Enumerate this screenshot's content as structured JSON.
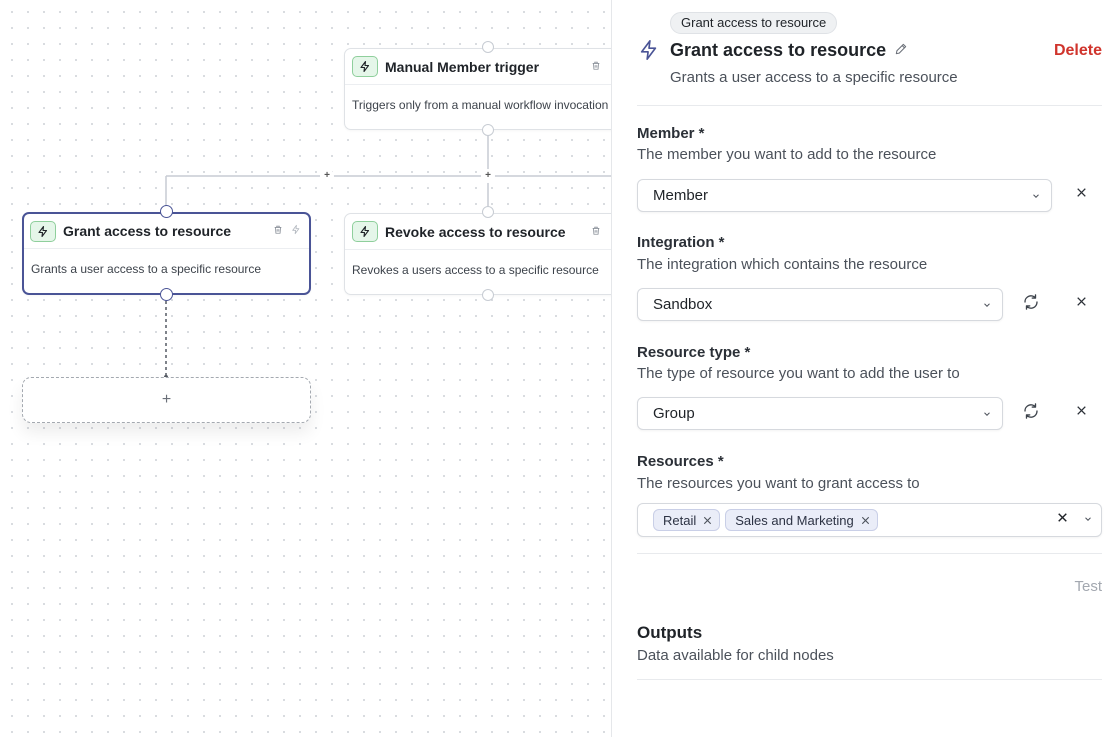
{
  "canvas": {
    "nodes": {
      "manual_trigger": {
        "title": "Manual Member trigger",
        "description": "Triggers only from a manual workflow invocation"
      },
      "grant": {
        "title": "Grant access to resource",
        "description": "Grants a user access to a specific resource"
      },
      "revoke": {
        "title": "Revoke access to resource",
        "description": "Revokes a users access to a specific resource"
      }
    },
    "add_node_label": "+",
    "plus_label": "+"
  },
  "panel": {
    "chip": "Grant access to resource",
    "title": "Grant access to resource",
    "subtitle": "Grants a user access to a specific resource",
    "delete_label": "Delete",
    "fields": {
      "member": {
        "label": "Member *",
        "help": "The member you want to add to the resource",
        "value": "Member"
      },
      "integration": {
        "label": "Integration *",
        "help": "The integration which contains the resource",
        "value": "Sandbox"
      },
      "resource_type": {
        "label": "Resource type *",
        "help": "The type of resource you want to add the user to",
        "value": "Group"
      },
      "resources": {
        "label": "Resources *",
        "help": "The resources you want to grant access to",
        "tags": [
          "Retail",
          "Sales and Marketing"
        ]
      }
    },
    "test_label": "Test",
    "outputs": {
      "title": "Outputs",
      "help": "Data available for child nodes"
    }
  },
  "colors": {
    "accent": "#4a5496",
    "danger": "#d0342c",
    "node_badge_bg": "#e5f6e9",
    "node_badge_border": "#8fcf9c"
  },
  "icons": [
    "bolt-icon",
    "trash-icon",
    "pencil-icon",
    "chevron-down-icon",
    "refresh-icon",
    "close-icon"
  ]
}
